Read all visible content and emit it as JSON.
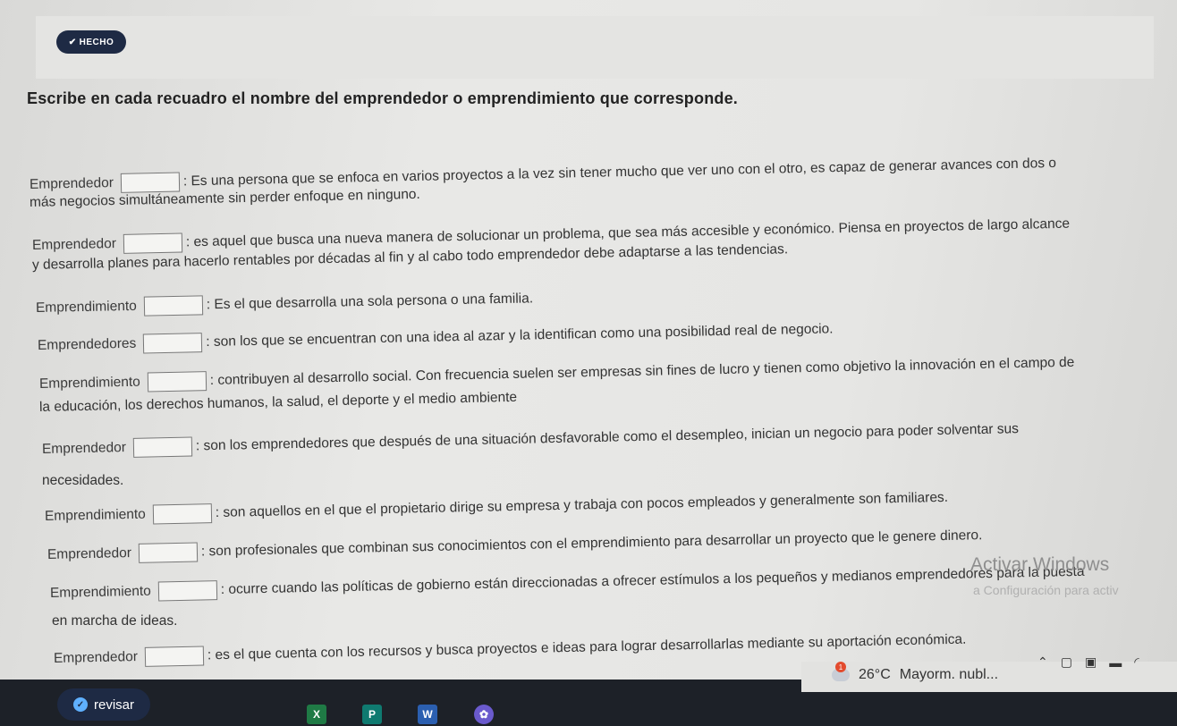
{
  "header": {
    "done_label": "HECHO",
    "title": "Escribe en cada recuadro el nombre del emprendedor o emprendimiento que corresponde."
  },
  "items": [
    {
      "label": "Emprendedor",
      "text": ": Es una persona que se enfoca en varios proyectos a la vez sin tener mucho que ver uno con el otro, es capaz de generar avances con dos o"
    },
    {
      "label": "Emprendedor",
      "text": ": es aquel que busca una nueva manera de solucionar un problema, que sea más accesible y económico. Piensa en proyectos de largo alcance"
    },
    {
      "label": "Emprendimiento",
      "text": ": Es el que desarrolla una sola persona o una familia."
    },
    {
      "label": "Emprendedores",
      "text": ": son los que se encuentran con una idea al azar y la identifican como una posibilidad real de negocio."
    },
    {
      "label": "Emprendimiento",
      "text": ": contribuyen al desarrollo social. Con frecuencia suelen ser empresas sin fines de lucro y tienen como objetivo la innovación en el campo de"
    },
    {
      "label": "Emprendedor",
      "text": ": son los emprendedores que después de una situación desfavorable como el desempleo, inician un negocio para poder solventar sus"
    },
    {
      "label": "Emprendimiento",
      "text": ": son aquellos en el que el propietario dirige su empresa y trabaja con pocos empleados y generalmente son familiares."
    },
    {
      "label": "Emprendedor",
      "text": ": son profesionales que combinan sus conocimientos con el emprendimiento para desarrollar un proyecto que le genere dinero."
    },
    {
      "label": "Emprendimiento",
      "text": ": ocurre cuando las políticas de gobierno están direccionadas a ofrecer estímulos a los pequeños y medianos emprendedores para la puesta"
    },
    {
      "label": "Emprendedor",
      "text": ": es el que cuenta con los recursos y busca proyectos e ideas para lograr desarrollarlas mediante su aportación económica."
    }
  ],
  "continuations": [
    "más negocios simultáneamente sin perder enfoque en ninguno.",
    "y desarrolla planes para hacerlo rentables por décadas al fin y al cabo todo emprendedor debe adaptarse a las tendencias.",
    "la educación, los derechos humanos, la salud, el deporte y el medio ambiente",
    "necesidades.",
    "en marcha de ideas."
  ],
  "watermark": {
    "line1": "Activar Windows",
    "line2": "a Configuración para activ"
  },
  "footer": {
    "review_label": "revisar"
  },
  "taskbar": {
    "temperature": "26°C",
    "weather_text": "Mayorm. nubl...",
    "notification_count": "1",
    "apps": [
      "excel-icon",
      "publisher-icon",
      "word-icon",
      "paint-icon"
    ]
  },
  "colors": {
    "dark_pill": "#1e2a44",
    "taskbar": "#1d2128",
    "excel": "#1f7a45",
    "publisher": "#0f7a70",
    "word": "#2b5fb0"
  }
}
